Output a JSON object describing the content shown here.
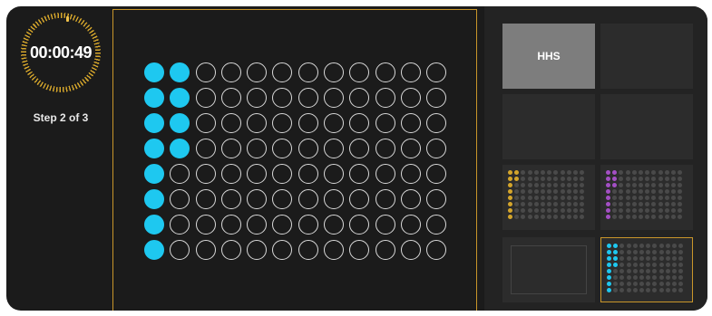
{
  "timer": {
    "time": "00:00:49"
  },
  "step": {
    "text": "Step 2 of 3"
  },
  "plate": {
    "rows": 8,
    "cols": 12,
    "filled_counts_by_col": [
      8,
      4
    ],
    "fill_color": "#1ec8f0",
    "empty_outline_color": "#d9d9d9"
  },
  "tiles": [
    {
      "label": "HHS",
      "type": "label"
    },
    {
      "label": "",
      "type": "blank"
    },
    {
      "label": "",
      "type": "blank"
    },
    {
      "label": "",
      "type": "blank"
    },
    {
      "label": "",
      "type": "mini-plate",
      "color": "#d4a52b",
      "filled_counts_by_col": [
        8,
        2
      ]
    },
    {
      "label": "",
      "type": "mini-plate",
      "color": "#a34fc4",
      "filled_counts_by_col": [
        8,
        3
      ]
    },
    {
      "label": "",
      "type": "outline"
    },
    {
      "label": "",
      "type": "mini-plate",
      "color": "#1ec8f0",
      "filled_counts_by_col": [
        8,
        4
      ],
      "selected": true
    }
  ],
  "colors": {
    "accent": "#c9962a",
    "background": "#1b1b1b"
  }
}
